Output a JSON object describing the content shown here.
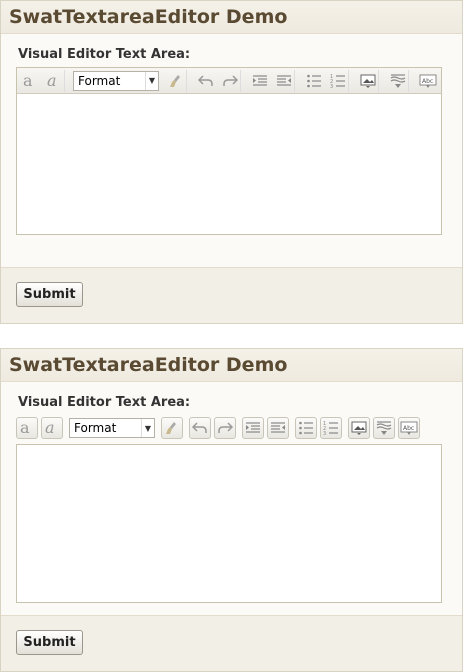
{
  "page_title": "SwatTextareaEditor Demo",
  "field_label": "Visual Editor Text Area:",
  "format_select": {
    "selected": "Format"
  },
  "submit_label": "Submit",
  "toolbar_icons": [
    "bold-icon",
    "italic-icon",
    "format-select",
    "clean-icon",
    "undo-icon",
    "redo-icon",
    "indent-icon",
    "outdent-icon",
    "bullet-list-icon",
    "numbered-list-icon",
    "image-icon",
    "paste-icon",
    "spellcheck-icon"
  ],
  "spellcheck_text": "Abc"
}
